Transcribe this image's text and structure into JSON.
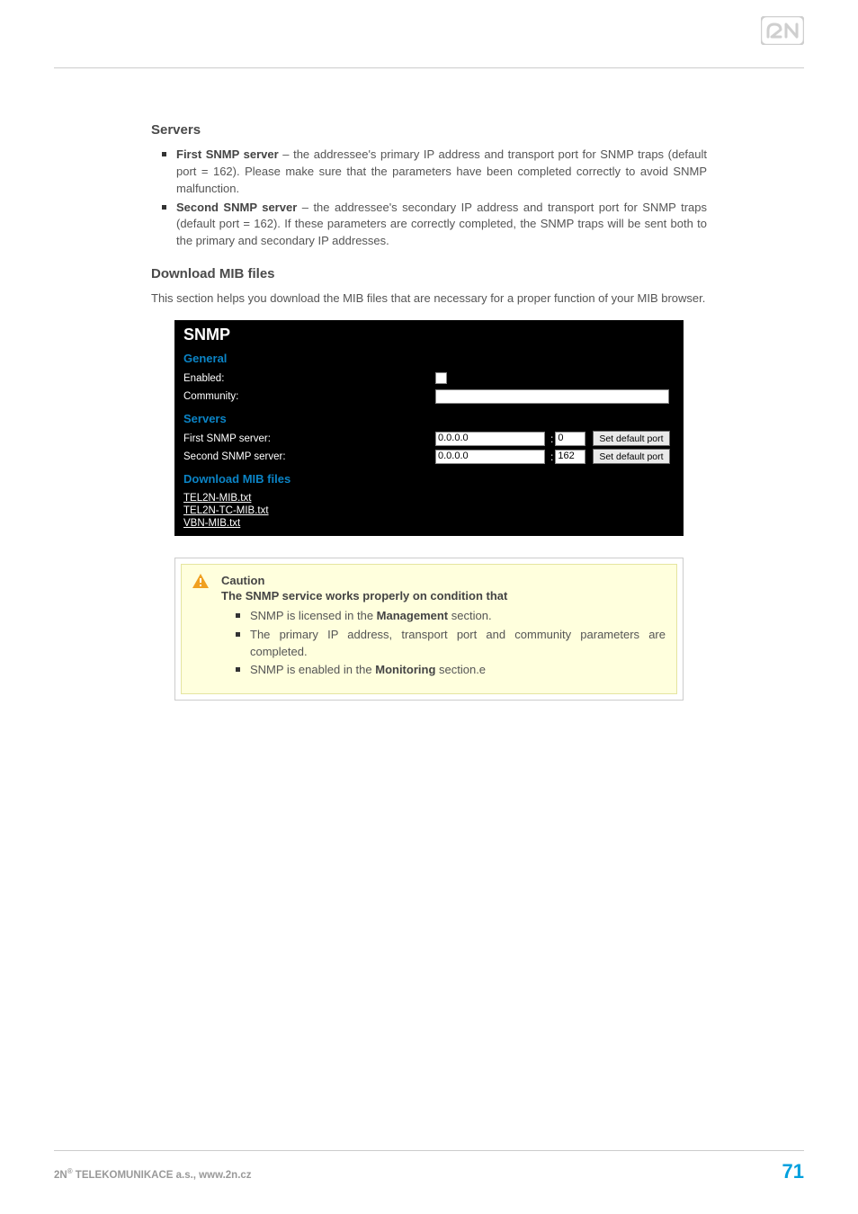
{
  "page": {
    "footer_text": "2N® TELEKOMUNIKACE a.s., www.2n.cz",
    "footer_text_prefix": "2N",
    "footer_text_suffix": " TELEKOMUNIKACE a.s., www.2n.cz",
    "page_number": "71"
  },
  "section_servers": {
    "heading": "Servers",
    "items": [
      {
        "label": "First SNMP server",
        "text": " – the addressee's primary IP address and transport port for SNMP traps (default port = 162). Please make sure that the parameters have been completed correctly to avoid SNMP malfunction."
      },
      {
        "label": "Second SNMP server",
        "text": " – the addressee's secondary IP address and transport port for SNMP traps (default port = 162). If these parameters are correctly completed, the SNMP traps will be sent both to the primary and secondary IP addresses."
      }
    ]
  },
  "section_download": {
    "heading": "Download MIB files",
    "paragraph": "This section helps you download the MIB files that are necessary for a proper function of your MIB browser."
  },
  "screenshot": {
    "title": "SNMP",
    "general_heading": "General",
    "enabled_label": "Enabled:",
    "community_label": "Community:",
    "community_value": "",
    "servers_heading": "Servers",
    "first_label": "First SNMP server:",
    "second_label": "Second SNMP server:",
    "first_ip": "0.0.0.0",
    "first_port": "0",
    "second_ip": "0.0.0.0",
    "second_port": "162",
    "btn_default": "Set default port",
    "download_heading": "Download MIB files",
    "links": [
      "TEL2N-MIB.txt",
      "TEL2N-TC-MIB.txt",
      "VBN-MIB.txt"
    ]
  },
  "caution": {
    "title": "Caution",
    "subtitle": "The SNMP service works properly on condition that",
    "items": [
      {
        "pre": "SNMP is licensed in the ",
        "bold": "Management",
        "post": " section."
      },
      {
        "pre": "The primary IP address, transport port and community parameters are completed.",
        "bold": "",
        "post": ""
      },
      {
        "pre": "SNMP is enabled in the ",
        "bold": "Monitoring",
        "post": " section.e"
      }
    ]
  }
}
